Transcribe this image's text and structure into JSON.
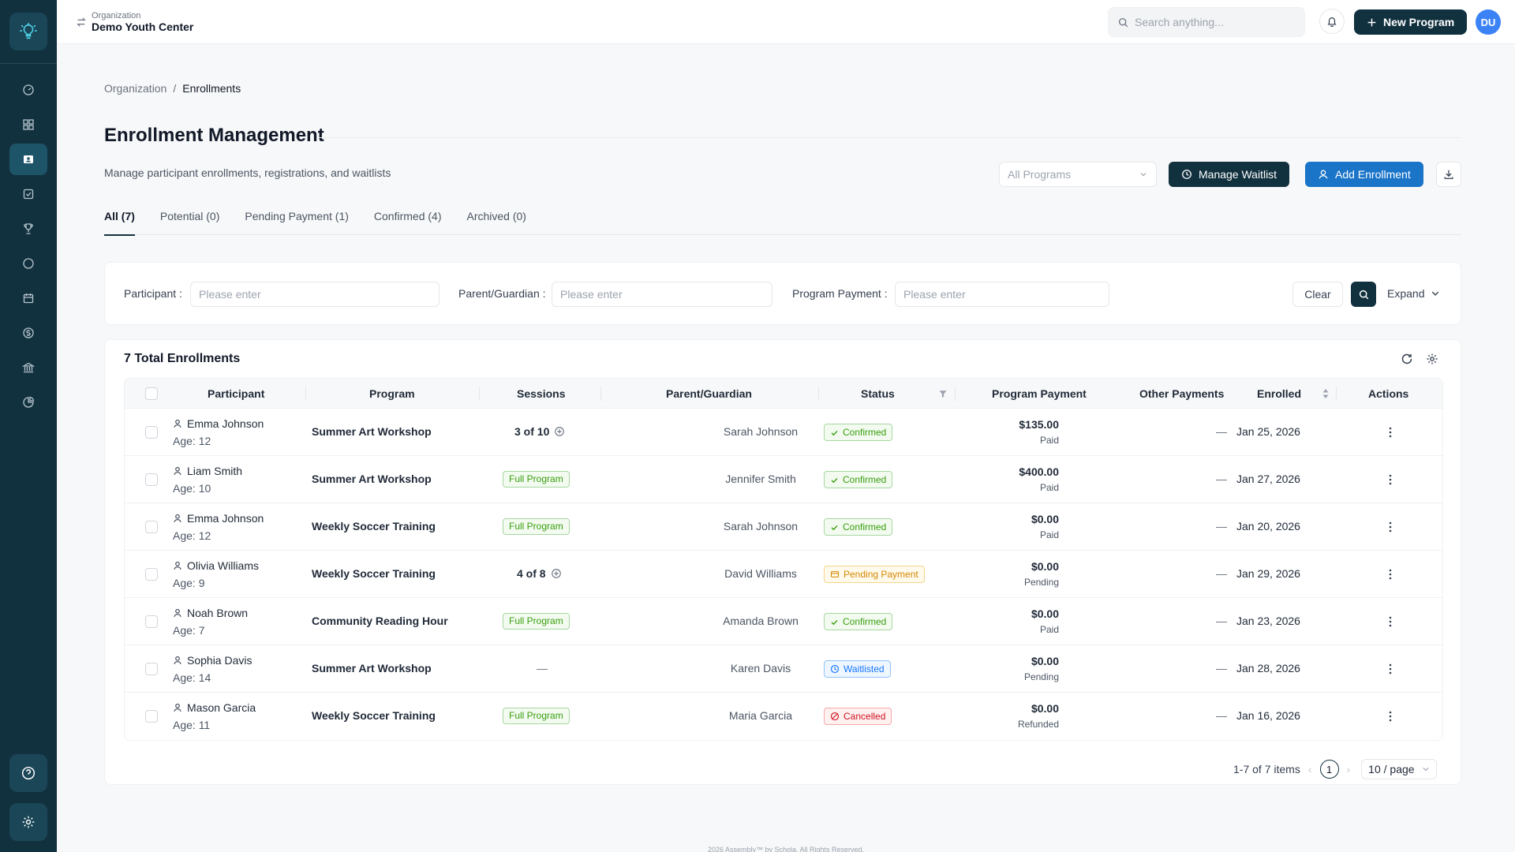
{
  "org": {
    "label": "Organization",
    "name": "Demo Youth Center"
  },
  "search": {
    "placeholder": "Search anything..."
  },
  "topbar": {
    "new_program_label": "New Program",
    "avatar_initials": "DU"
  },
  "breadcrumb": {
    "parent": "Organization",
    "separator": "/",
    "current": "Enrollments"
  },
  "page": {
    "title": "Enrollment Management",
    "subtitle": "Manage participant enrollments, registrations, and waitlists",
    "program_select_placeholder": "All Programs",
    "manage_waitlist_label": "Manage Waitlist",
    "add_enrollment_label": "Add Enrollment"
  },
  "tabs": [
    {
      "label": "All (7)"
    },
    {
      "label": "Potential (0)"
    },
    {
      "label": "Pending Payment (1)"
    },
    {
      "label": "Confirmed (4)"
    },
    {
      "label": "Archived (0)"
    }
  ],
  "filters": {
    "participant_label": "Participant",
    "participant_placeholder": "Please enter",
    "parent_label": "Parent/Guardian",
    "parent_placeholder": "Please enter",
    "payment_label": "Program Payment",
    "payment_placeholder": "Please enter",
    "colon": ":",
    "clear_label": "Clear",
    "expand_label": "Expand"
  },
  "table": {
    "title": "7 Total Enrollments",
    "columns": {
      "participant": "Participant",
      "program": "Program",
      "sessions": "Sessions",
      "parent": "Parent/Guardian",
      "status": "Status",
      "program_payment": "Program Payment",
      "other_payments": "Other Payments",
      "enrolled": "Enrolled",
      "actions": "Actions"
    },
    "rows": [
      {
        "name": "Emma Johnson",
        "age": "Age: 12",
        "program": "Summer Art Workshop",
        "sessions": "3 of 10",
        "parent": "Sarah Johnson",
        "status": "Confirmed",
        "amount": "$135.00",
        "pay_status": "Paid",
        "other": "—",
        "enrolled": "Jan 25, 2026"
      },
      {
        "name": "Liam Smith",
        "age": "Age: 10",
        "program": "Summer Art Workshop",
        "sessions": "Full Program",
        "parent": "Jennifer Smith",
        "status": "Confirmed",
        "amount": "$400.00",
        "pay_status": "Paid",
        "other": "—",
        "enrolled": "Jan 27, 2026"
      },
      {
        "name": "Emma Johnson",
        "age": "Age: 12",
        "program": "Weekly Soccer Training",
        "sessions": "Full Program",
        "parent": "Sarah Johnson",
        "status": "Confirmed",
        "amount": "$0.00",
        "pay_status": "Paid",
        "other": "—",
        "enrolled": "Jan 20, 2026"
      },
      {
        "name": "Olivia Williams",
        "age": "Age: 9",
        "program": "Weekly Soccer Training",
        "sessions": "4 of 8",
        "parent": "David Williams",
        "status": "Pending Payment",
        "amount": "$0.00",
        "pay_status": "Pending",
        "other": "—",
        "enrolled": "Jan 29, 2026"
      },
      {
        "name": "Noah Brown",
        "age": "Age: 7",
        "program": "Community Reading Hour",
        "sessions": "Full Program",
        "parent": "Amanda Brown",
        "status": "Confirmed",
        "amount": "$0.00",
        "pay_status": "Paid",
        "other": "—",
        "enrolled": "Jan 23, 2026"
      },
      {
        "name": "Sophia Davis",
        "age": "Age: 14",
        "program": "Summer Art Workshop",
        "sessions": "—",
        "parent": "Karen Davis",
        "status": "Waitlisted",
        "amount": "$0.00",
        "pay_status": "Pending",
        "other": "—",
        "enrolled": "Jan 28, 2026"
      },
      {
        "name": "Mason Garcia",
        "age": "Age: 11",
        "program": "Weekly Soccer Training",
        "sessions": "Full Program",
        "parent": "Maria Garcia",
        "status": "Cancelled",
        "amount": "$0.00",
        "pay_status": "Refunded",
        "other": "—",
        "enrolled": "Jan 16, 2026"
      }
    ]
  },
  "pagination": {
    "summary": "1-7 of 7 items",
    "current_page": "1",
    "page_size": "10 / page"
  },
  "footer": "2026 Assembly™ by Schola. All Rights Reserved.",
  "colors": {
    "sidebar": "#12313f",
    "primary": "#12313f",
    "accent_blue": "#1a74c8"
  }
}
